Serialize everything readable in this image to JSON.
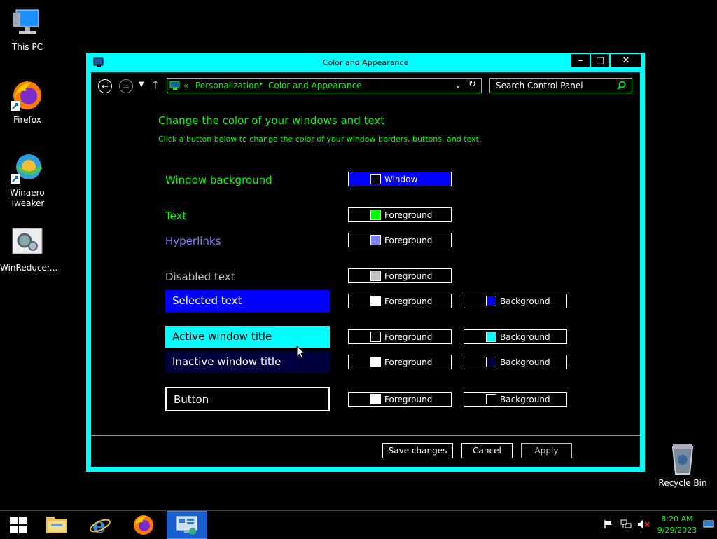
{
  "desktop": {
    "icons": [
      {
        "label": "This PC"
      },
      {
        "label": "Firefox"
      },
      {
        "label": "Winaero\nTweaker"
      },
      {
        "label": "WinReducer..."
      },
      {
        "label": "Recycle Bin"
      }
    ]
  },
  "window": {
    "title": "Color and Appearance",
    "controls": {
      "minimize": "–",
      "maximize": "□",
      "close": "✕"
    },
    "breadcrumb": {
      "prefix": "«",
      "items": [
        "Personalization",
        "Color and Appearance"
      ],
      "separator": "▸"
    },
    "search": {
      "placeholder": "Search Control Panel"
    },
    "heading": "Change the color of your windows and text",
    "subheading": "Click a button below to change the color of your window borders, buttons, and text.",
    "rows": [
      {
        "label": "Window background",
        "label_color": "#00ff00",
        "buttons": [
          {
            "text": "Window",
            "swatch": "#000000",
            "bg": "#0000ff"
          }
        ]
      },
      {
        "label": "Text",
        "label_color": "#00ff00",
        "buttons": [
          {
            "text": "Foreground",
            "swatch": "#00ff00"
          }
        ]
      },
      {
        "label": "Hyperlinks",
        "label_color": "#8080ff",
        "buttons": [
          {
            "text": "Foreground",
            "swatch": "#8080ff"
          }
        ]
      },
      {
        "label": "Disabled text",
        "label_color": "#c0c0c0",
        "buttons": [
          {
            "text": "Foreground",
            "swatch": "#c0c0c0"
          }
        ]
      },
      {
        "label": "Selected text",
        "sample_bg": "#0000ff",
        "sample_fg": "#ffffff",
        "buttons": [
          {
            "text": "Foreground",
            "swatch": "#ffffff"
          },
          {
            "text": "Background",
            "swatch": "#0000ff"
          }
        ]
      },
      {
        "label": "Active window title",
        "sample_bg": "#00ffff",
        "sample_fg": "#000000",
        "buttons": [
          {
            "text": "Foreground",
            "swatch": "#000000"
          },
          {
            "text": "Background",
            "swatch": "#00ffff"
          }
        ]
      },
      {
        "label": "Inactive window title",
        "sample_bg": "#000040",
        "sample_fg": "#ffffff",
        "buttons": [
          {
            "text": "Foreground",
            "swatch": "#ffffff"
          },
          {
            "text": "Background",
            "swatch": "#000040"
          }
        ]
      },
      {
        "label": "Button",
        "sample_bg": "#000000",
        "sample_fg": "#ffffff",
        "buttons": [
          {
            "text": "Foreground",
            "swatch": "#ffffff"
          },
          {
            "text": "Background",
            "swatch": "#000000"
          }
        ]
      }
    ],
    "footer": {
      "save": "Save changes",
      "cancel": "Cancel",
      "apply": "Apply"
    }
  },
  "taskbar": {
    "clock": {
      "time": "8:20 AM",
      "date": "9/29/2023"
    }
  },
  "colors": {
    "accent": "#00ffff",
    "text_green": "#00ff00",
    "hyperlink": "#8080ff"
  }
}
